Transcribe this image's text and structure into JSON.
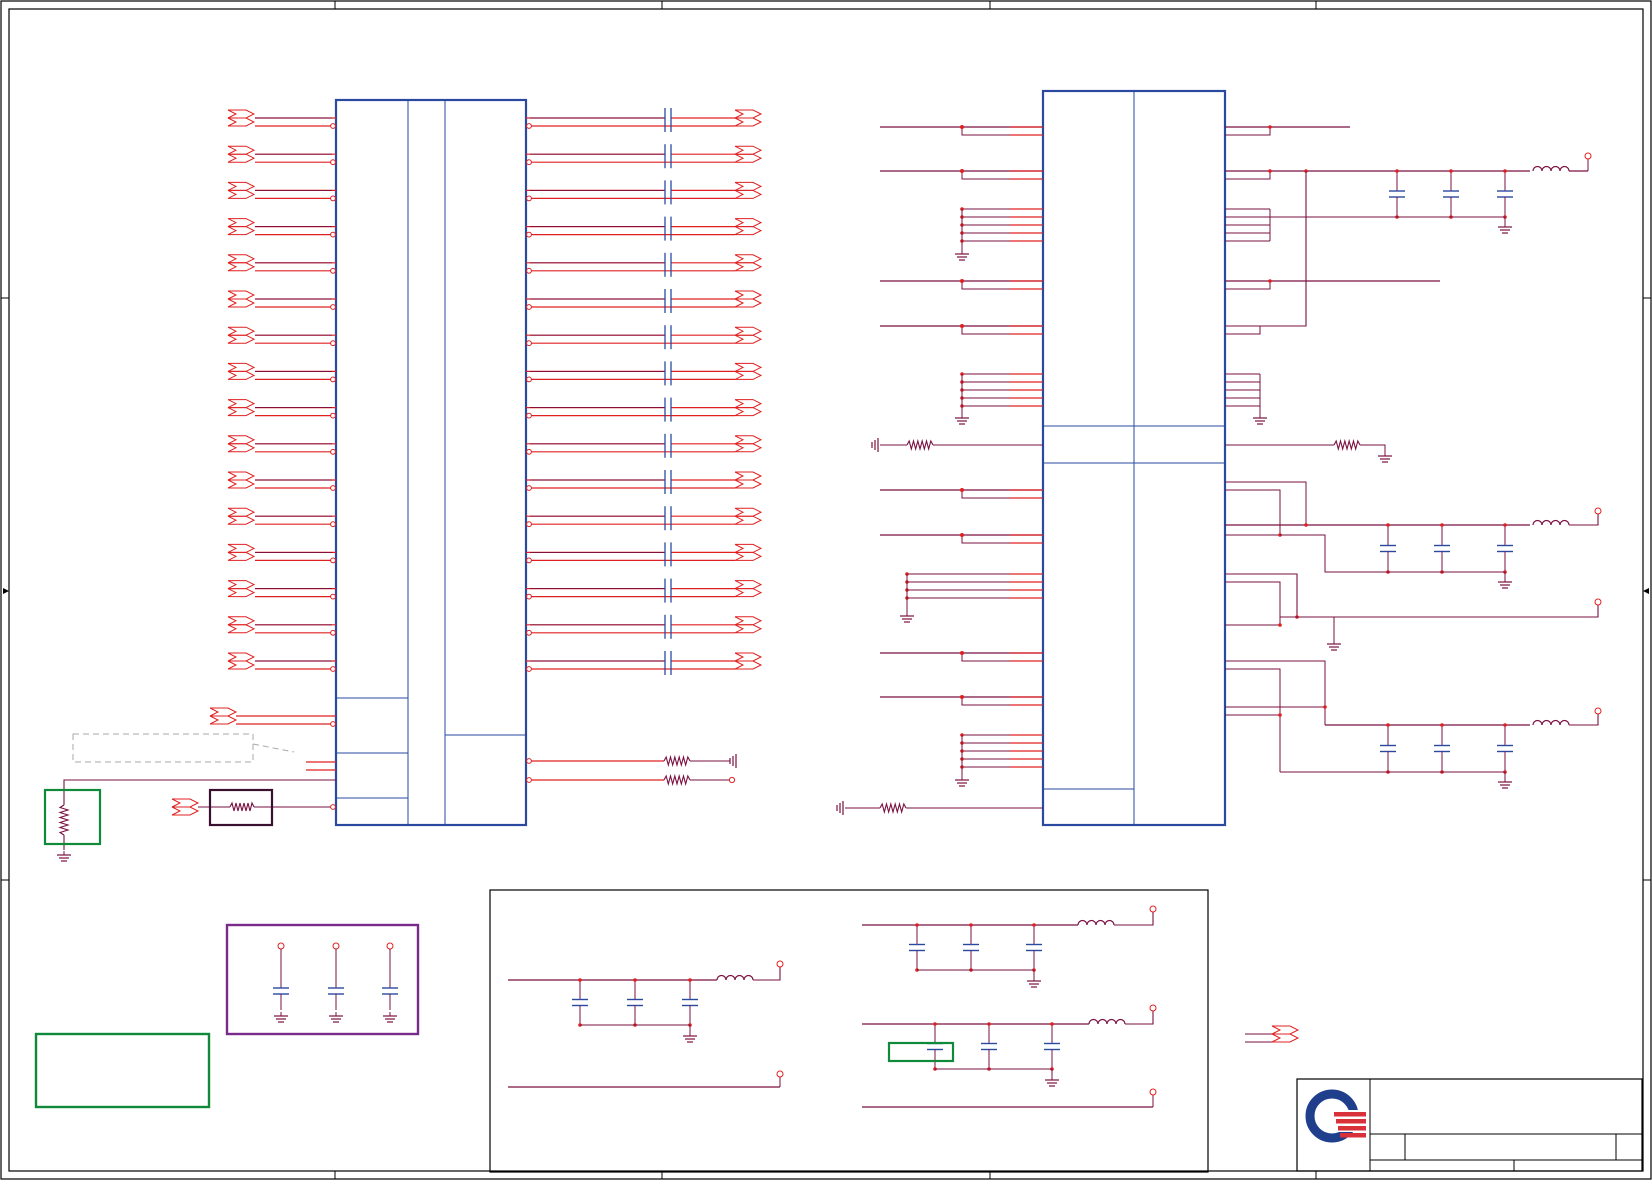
{
  "schematic": {
    "colors": {
      "border": "#000000",
      "component": "#2a4aa0",
      "pin": "#e02020",
      "wire": "#7a1040",
      "note_green": "#108a3a",
      "note_purple": "#7a2a8a",
      "note_dark": "#3a1030",
      "note_dashed": "#aaaaaa",
      "logo_blue": "#1f3e8c",
      "logo_red": "#d8313a"
    },
    "blocks": [
      {
        "name": "connector-left"
      },
      {
        "name": "ic-right"
      },
      {
        "name": "power-filter-section"
      },
      {
        "name": "title-block"
      }
    ]
  }
}
